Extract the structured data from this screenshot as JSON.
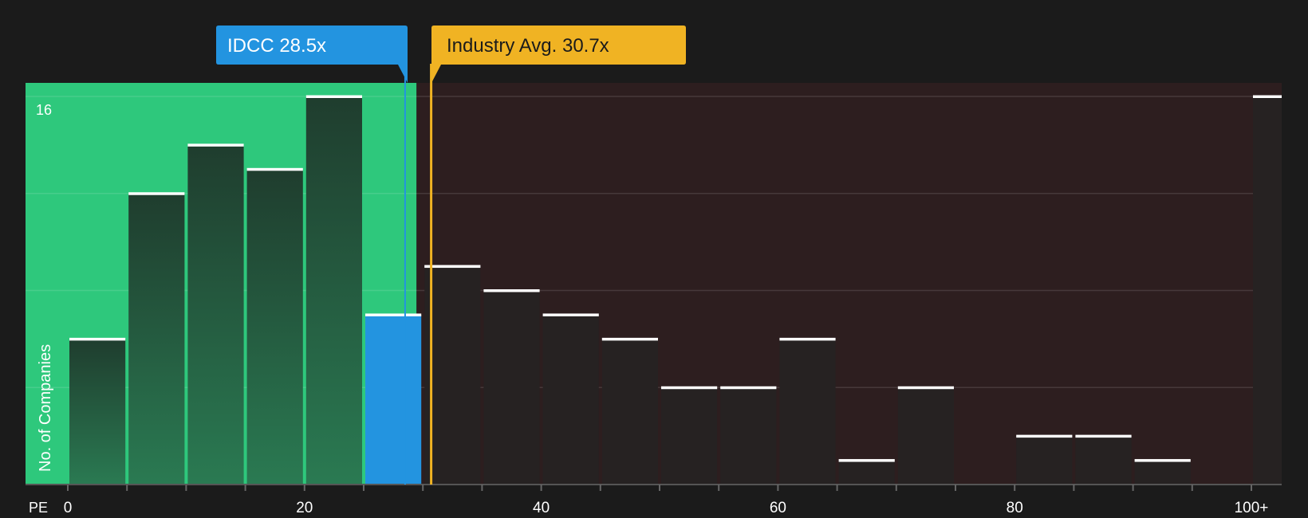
{
  "chart_data": {
    "type": "bar",
    "xlabel": "PE",
    "ylabel": "No. of Companies",
    "x_tick_labels": [
      "0",
      "20",
      "40",
      "60",
      "80",
      "100+"
    ],
    "y_tick_label": "16",
    "ylim": [
      0,
      16.6
    ],
    "bin_width": 5,
    "bins": [
      {
        "start": 0,
        "count": 6
      },
      {
        "start": 5,
        "count": 12
      },
      {
        "start": 10,
        "count": 14
      },
      {
        "start": 15,
        "count": 13
      },
      {
        "start": 20,
        "count": 16
      },
      {
        "start": 25,
        "count": 7,
        "highlight": true
      },
      {
        "start": 30,
        "count": 9
      },
      {
        "start": 35,
        "count": 8
      },
      {
        "start": 40,
        "count": 7
      },
      {
        "start": 45,
        "count": 6
      },
      {
        "start": 50,
        "count": 4
      },
      {
        "start": 55,
        "count": 4
      },
      {
        "start": 60,
        "count": 6
      },
      {
        "start": 65,
        "count": 1
      },
      {
        "start": 70,
        "count": 4
      },
      {
        "start": 75,
        "count": 0
      },
      {
        "start": 80,
        "count": 2
      },
      {
        "start": 85,
        "count": 2
      },
      {
        "start": 90,
        "count": 1
      },
      {
        "start": 95,
        "count": 0
      },
      {
        "start": 100,
        "count": 16
      }
    ],
    "company": {
      "label": "IDCC 28.5x",
      "value": 28.5
    },
    "industry_avg": {
      "label": "Industry Avg. 30.7x",
      "value": 30.7
    },
    "grid": true
  },
  "colors": {
    "background": "#1b1b1b",
    "undervalued_zone": "#2ec87c",
    "overvalued_zone": "#2d1e1f",
    "company_bar": "#2394e0",
    "industry_line": "#f0b323",
    "bar_fill_dark": "#1f3a2c",
    "bar_fill_right": "#262222",
    "bar_top": "#ffffff"
  }
}
